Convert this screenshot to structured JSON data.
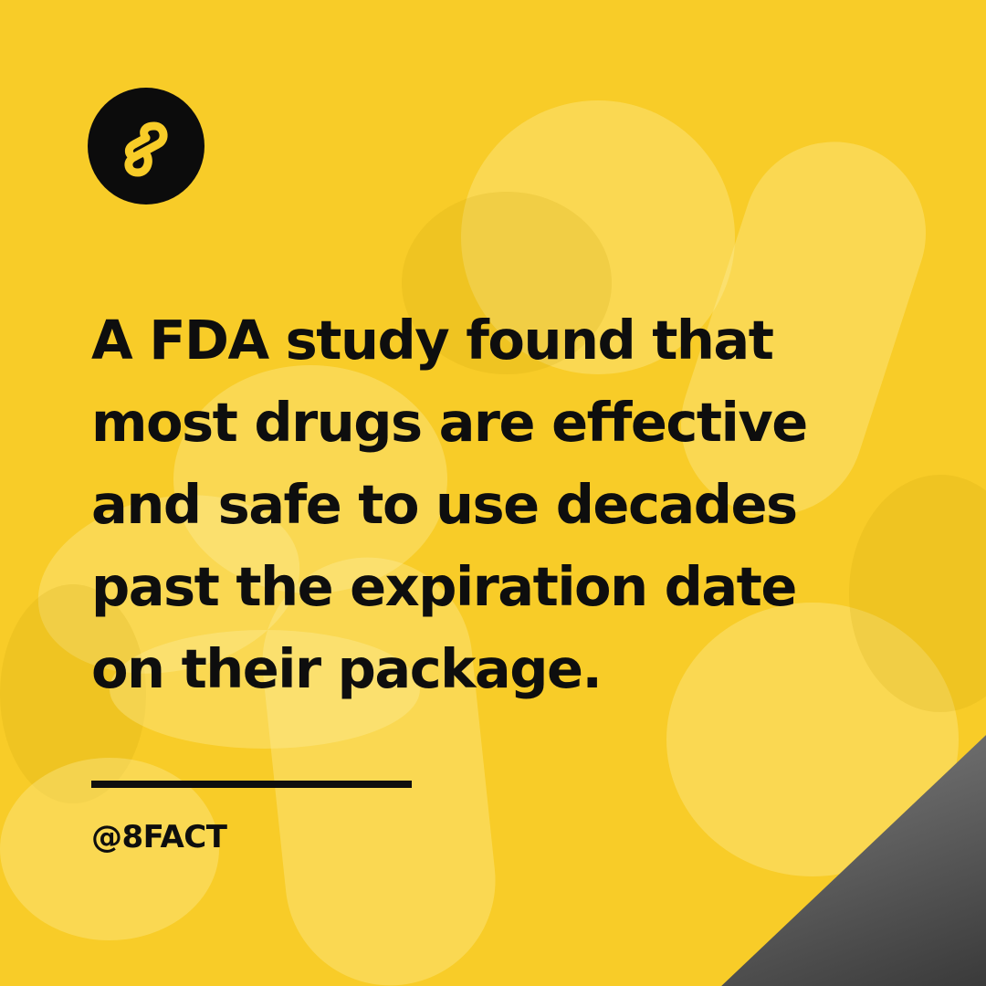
{
  "brand": {
    "logo_icon": "infinity-eight-icon",
    "handle": "@8FACT"
  },
  "post": {
    "headline": "A FDA study found that\nmost drugs are effective\nand safe to use decades\npast the expiration date\non their package."
  },
  "colors": {
    "background": "#f8cc28",
    "text": "#0e0e0e",
    "logo_bg": "#0c0c0c"
  }
}
